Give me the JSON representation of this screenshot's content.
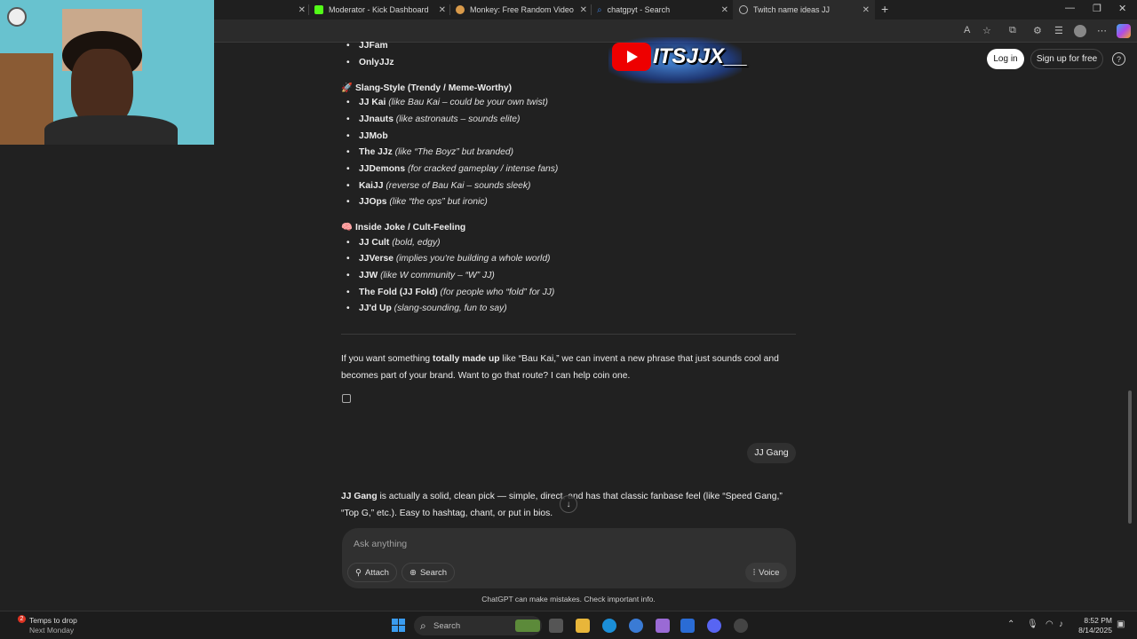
{
  "browser": {
    "tabs": [
      {
        "label": "Moderator - Kick Dashboard",
        "fav_color": "#53fc18"
      },
      {
        "label": "Monkey: Free Random Video Cha",
        "fav_color": "#d99a4a"
      },
      {
        "label": "chatgpyt - Search",
        "fav_color": "#3a7bd5"
      },
      {
        "label": "Twitch name ideas JJ",
        "fav_color": "#bbbbbb"
      }
    ],
    "close_glyph": "✕",
    "new_tab_glyph": "+",
    "window_controls": {
      "minimize": "—",
      "restore": "❐",
      "close": "✕"
    }
  },
  "overlay": {
    "channel_name": "ITSJJX__"
  },
  "header": {
    "login_label": "Log in",
    "signup_label": "Sign up for free",
    "help_glyph": "?"
  },
  "list_top": [
    "JJFam",
    "OnlyJJz"
  ],
  "section_slang": {
    "emoji": "🚀",
    "title": "Slang-Style (Trendy / Meme-Worthy)",
    "items": [
      {
        "name": "JJ Kai",
        "note": "(like Bau Kai – could be your own twist)"
      },
      {
        "name": "JJnauts",
        "note": "(like astronauts – sounds elite)"
      },
      {
        "name": "JJMob",
        "note": ""
      },
      {
        "name": "The JJz",
        "note": "(like “The Boyz” but branded)"
      },
      {
        "name": "JJDemons",
        "note": "(for cracked gameplay / intense fans)"
      },
      {
        "name": "KaiJJ",
        "note": "(reverse of Bau Kai – sounds sleek)"
      },
      {
        "name": "JJOps",
        "note": "(like “the ops” but ironic)"
      }
    ]
  },
  "section_inside": {
    "emoji": "🧠",
    "title": "Inside Joke / Cult-Feeling",
    "items": [
      {
        "name": "JJ Cult",
        "note": "(bold, edgy)"
      },
      {
        "name": "JJVerse",
        "note": "(implies you're building a whole world)"
      },
      {
        "name": "JJW",
        "note": "(like W community – “W” JJ)"
      },
      {
        "name": "The Fold (JJ Fold)",
        "note": "(for people who “fold” for JJ)"
      },
      {
        "name": "JJ'd Up",
        "note": "(slang-sounding, fun to say)"
      }
    ]
  },
  "paragraph1": {
    "pre": "If you want something ",
    "bold": "totally made up",
    "post": " like “Bau Kai,” we can invent a new phrase that just sounds cool and becomes part of your brand. Want to go that route? I can help coin one."
  },
  "user_message": "JJ Gang",
  "paragraph2": {
    "bold": "JJ Gang",
    "post": " is actually a solid, clean pick — simple, direct, and has that classic fanbase feel (like “Speed Gang,” “Top G,” etc.). Easy to hashtag, chant, or put in bios."
  },
  "composer": {
    "placeholder": "Ask anything",
    "attach_label": "Attach",
    "search_label": "Search",
    "voice_label": "Voice"
  },
  "disclaimer": "ChatGPT can make mistakes. Check important info.",
  "taskbar": {
    "weather_title": "Temps to drop",
    "weather_sub": "Next Monday",
    "weather_badge": "2",
    "search_label": "Search",
    "time": "8:52 PM",
    "date": "8/14/2025"
  }
}
